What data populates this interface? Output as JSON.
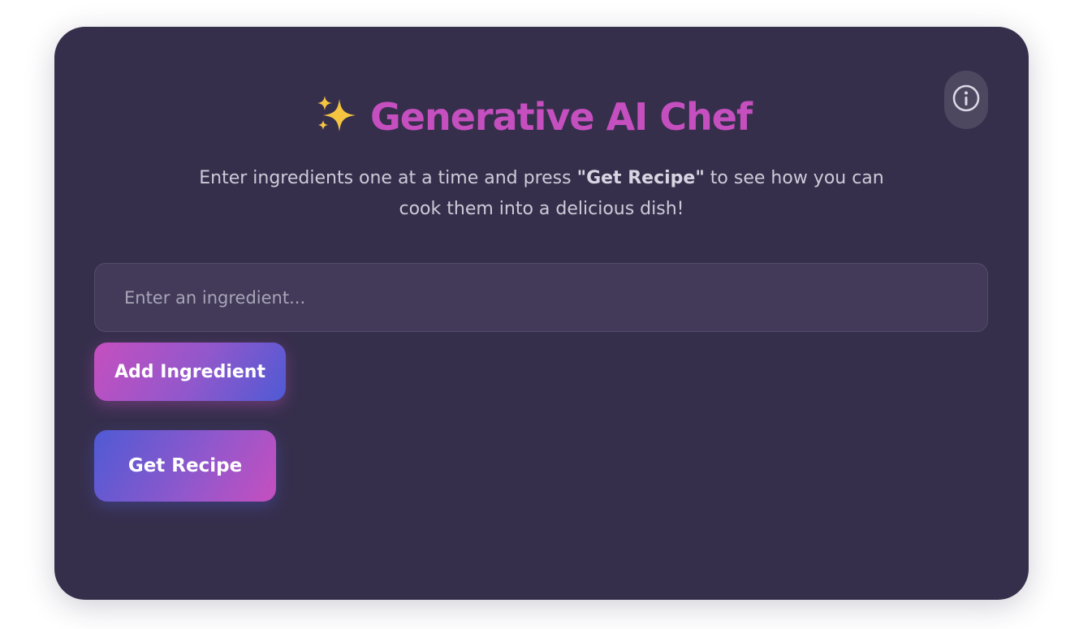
{
  "header": {
    "title": "Generative AI Chef",
    "sparkle_icon": "sparkles-icon",
    "info_icon": "info-icon"
  },
  "intro": {
    "text_before": "Enter ingredients one at a time and press ",
    "bold": "\"Get Recipe\"",
    "text_after": " to see how you can cook them into a delicious dish!"
  },
  "form": {
    "ingredient_placeholder": "Enter an ingredient...",
    "ingredient_value": "",
    "add_label": "Add Ingredient",
    "recipe_label": "Get Recipe"
  },
  "colors": {
    "card_background": "#362f4c",
    "title": "#c64fbf",
    "gradient_pink": "#c64fbf",
    "gradient_blue": "#4f5ad4",
    "sparkle": "#f5c542"
  }
}
